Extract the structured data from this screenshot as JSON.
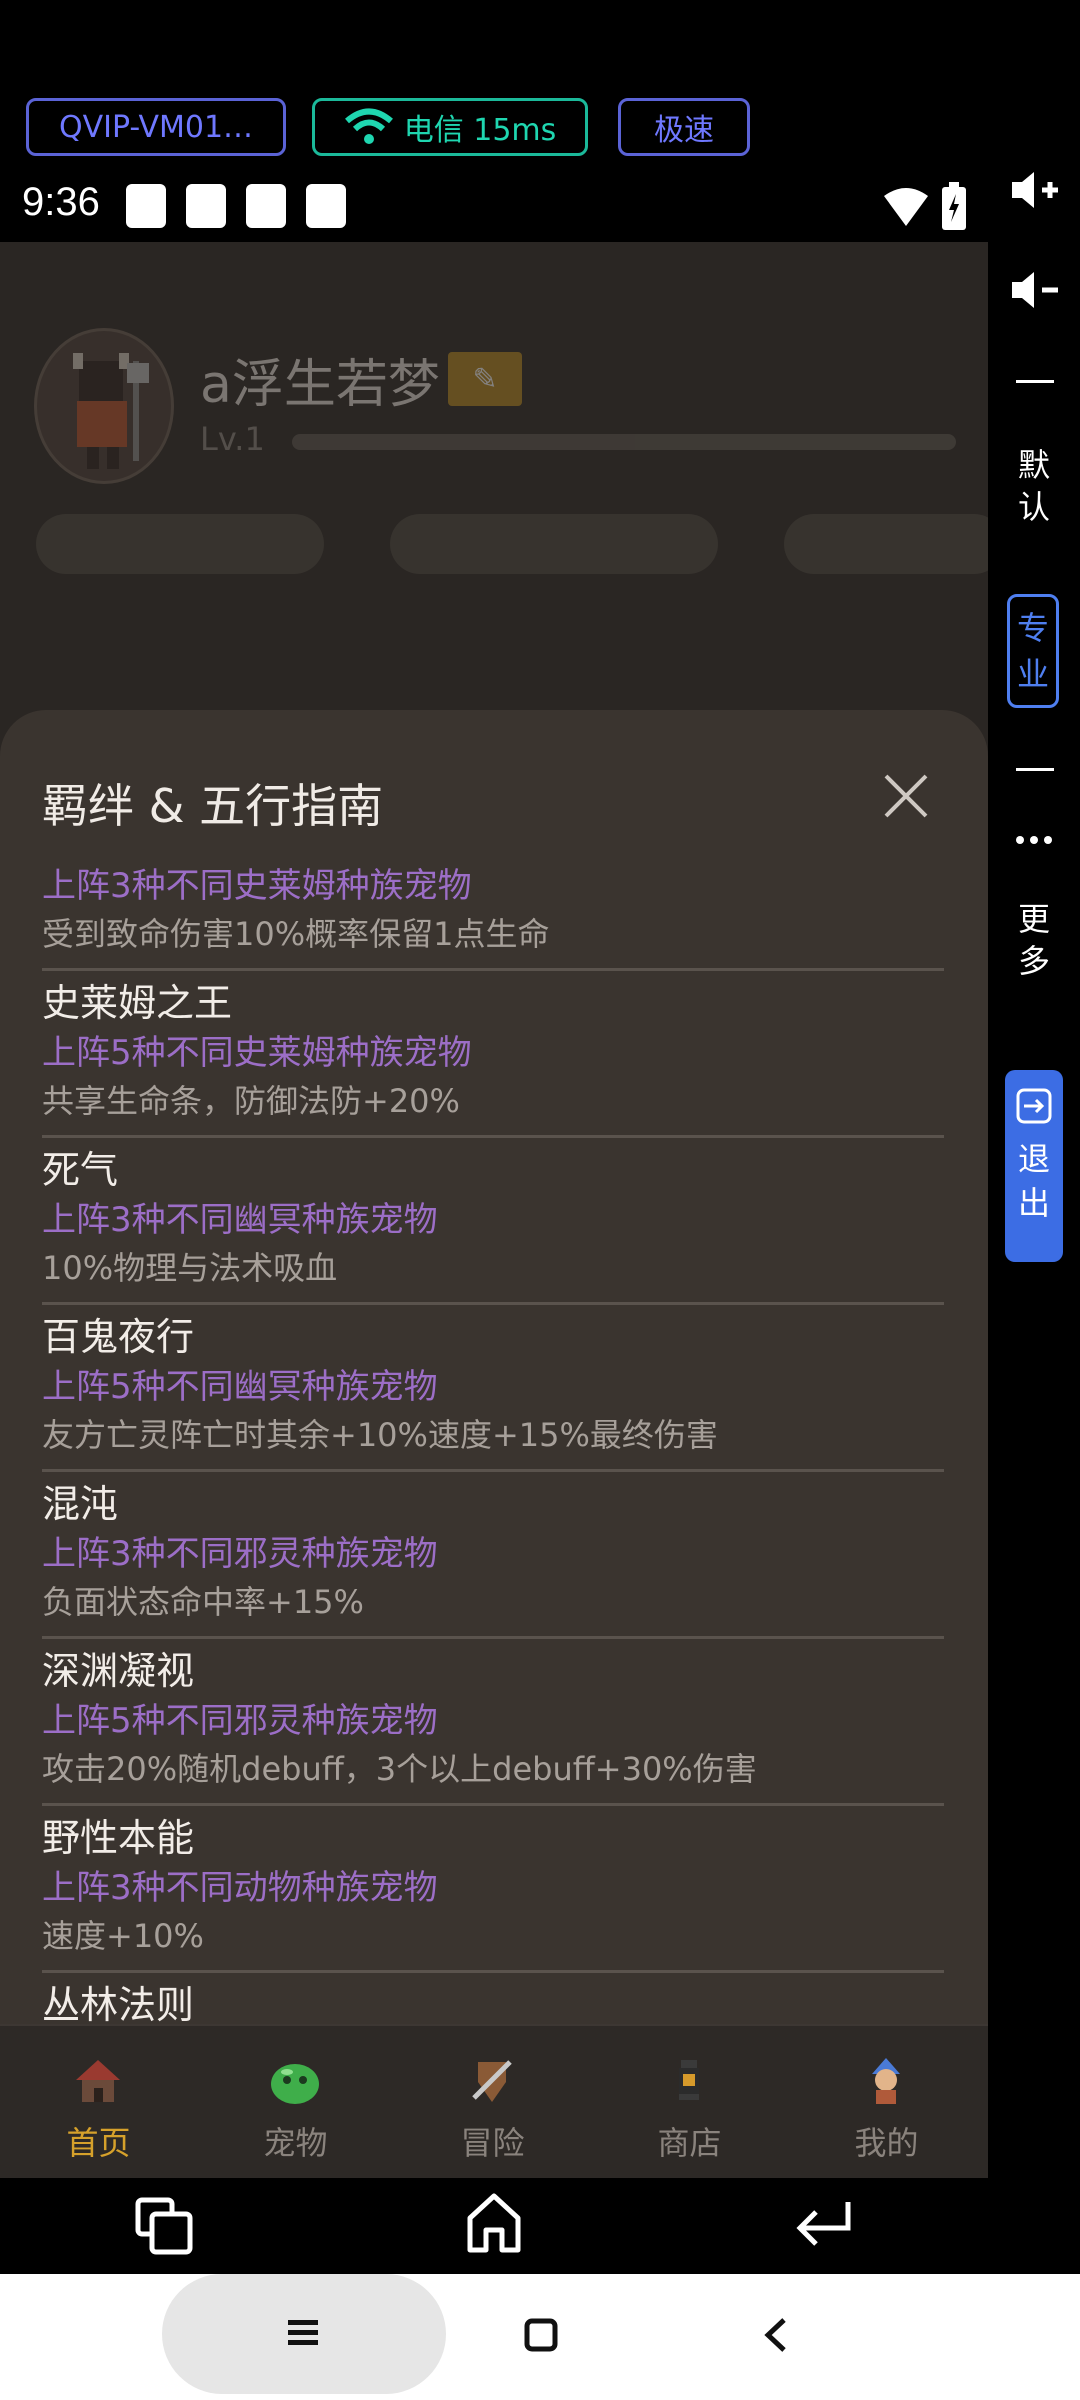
{
  "cloud_header": {
    "device_name": "QVIP-VM01…",
    "network": "电信 15ms",
    "speed": "极速"
  },
  "status_bar": {
    "time": "9:36"
  },
  "profile": {
    "name": "a浮生若梦",
    "level": "Lv.1"
  },
  "modal": {
    "title": "羁绊 & 五行指南",
    "entries": [
      {
        "name": "",
        "condition": "上阵3种不同史莱姆种族宠物",
        "effect": "受到致命伤害10%概率保留1点生命"
      },
      {
        "name": "史莱姆之王",
        "condition": "上阵5种不同史莱姆种族宠物",
        "effect": "共享生命条，防御法防+20%"
      },
      {
        "name": "死气",
        "condition": "上阵3种不同幽冥种族宠物",
        "effect": "10%物理与法术吸血"
      },
      {
        "name": "百鬼夜行",
        "condition": "上阵5种不同幽冥种族宠物",
        "effect": "友方亡灵阵亡时其余+10%速度+15%最终伤害"
      },
      {
        "name": "混沌",
        "condition": "上阵3种不同邪灵种族宠物",
        "effect": "负面状态命中率+15%"
      },
      {
        "name": "深渊凝视",
        "condition": "上阵5种不同邪灵种族宠物",
        "effect": "攻击20%随机debuff，3个以上debuff+30%伤害"
      },
      {
        "name": "野性本能",
        "condition": "上阵3种不同动物种族宠物",
        "effect": "速度+10%"
      },
      {
        "name": "丛林法则",
        "condition": "",
        "effect": ""
      }
    ]
  },
  "bottom_nav": [
    {
      "label": "首页",
      "icon": "house-icon",
      "active": true
    },
    {
      "label": "宠物",
      "icon": "slime-icon",
      "active": false
    },
    {
      "label": "冒险",
      "icon": "sword-shield-icon",
      "active": false
    },
    {
      "label": "商店",
      "icon": "lantern-icon",
      "active": false
    },
    {
      "label": "我的",
      "icon": "character-icon",
      "active": false
    }
  ],
  "side_toolbar": {
    "default_label": "默认",
    "pro_label": "专业",
    "more_label": "更多",
    "exit_label": "退出"
  },
  "colors": {
    "modal_bg": "#3a342f",
    "condition_purple": "#9c6ec7",
    "active_gold": "#d6a12b",
    "accent_blue": "#3c6de4"
  }
}
